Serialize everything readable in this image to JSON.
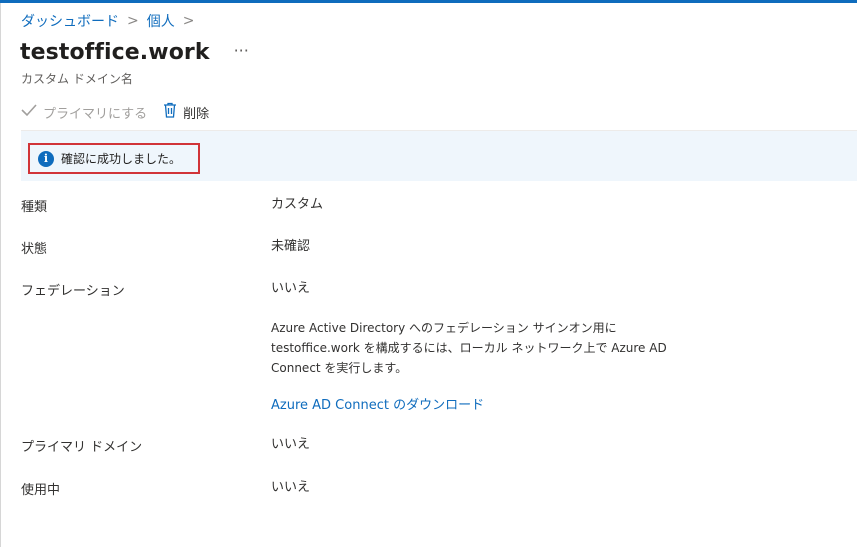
{
  "breadcrumb": {
    "items": [
      "ダッシュボード",
      "個人"
    ],
    "separator": ">"
  },
  "header": {
    "title": "testoffice.work",
    "subtitle": "カスタム ドメイン名",
    "more": "···"
  },
  "toolbar": {
    "make_primary": "プライマリにする",
    "delete": "削除"
  },
  "banner": {
    "message": "確認に成功しました。",
    "icon": "info-icon"
  },
  "details": {
    "type_label": "種類",
    "type_value": "カスタム",
    "status_label": "状態",
    "status_value": "未確認",
    "federation_label": "フェデレーション",
    "federation_value": "いいえ",
    "federation_desc_1": "Azure Active Directory へのフェデレーション サインオン用に",
    "federation_desc_2": "testoffice.work を構成するには、ローカル ネットワーク上で Azure AD",
    "federation_desc_3": "Connect を実行します。",
    "download_link": "Azure AD Connect のダウンロード",
    "primary_label": "プライマリ ドメイン",
    "primary_value": "いいえ",
    "inuse_label": "使用中",
    "inuse_value": "いいえ"
  },
  "colors": {
    "accent": "#0f6cbd",
    "highlight": "#d13438",
    "banner_bg": "#eff6fc"
  }
}
